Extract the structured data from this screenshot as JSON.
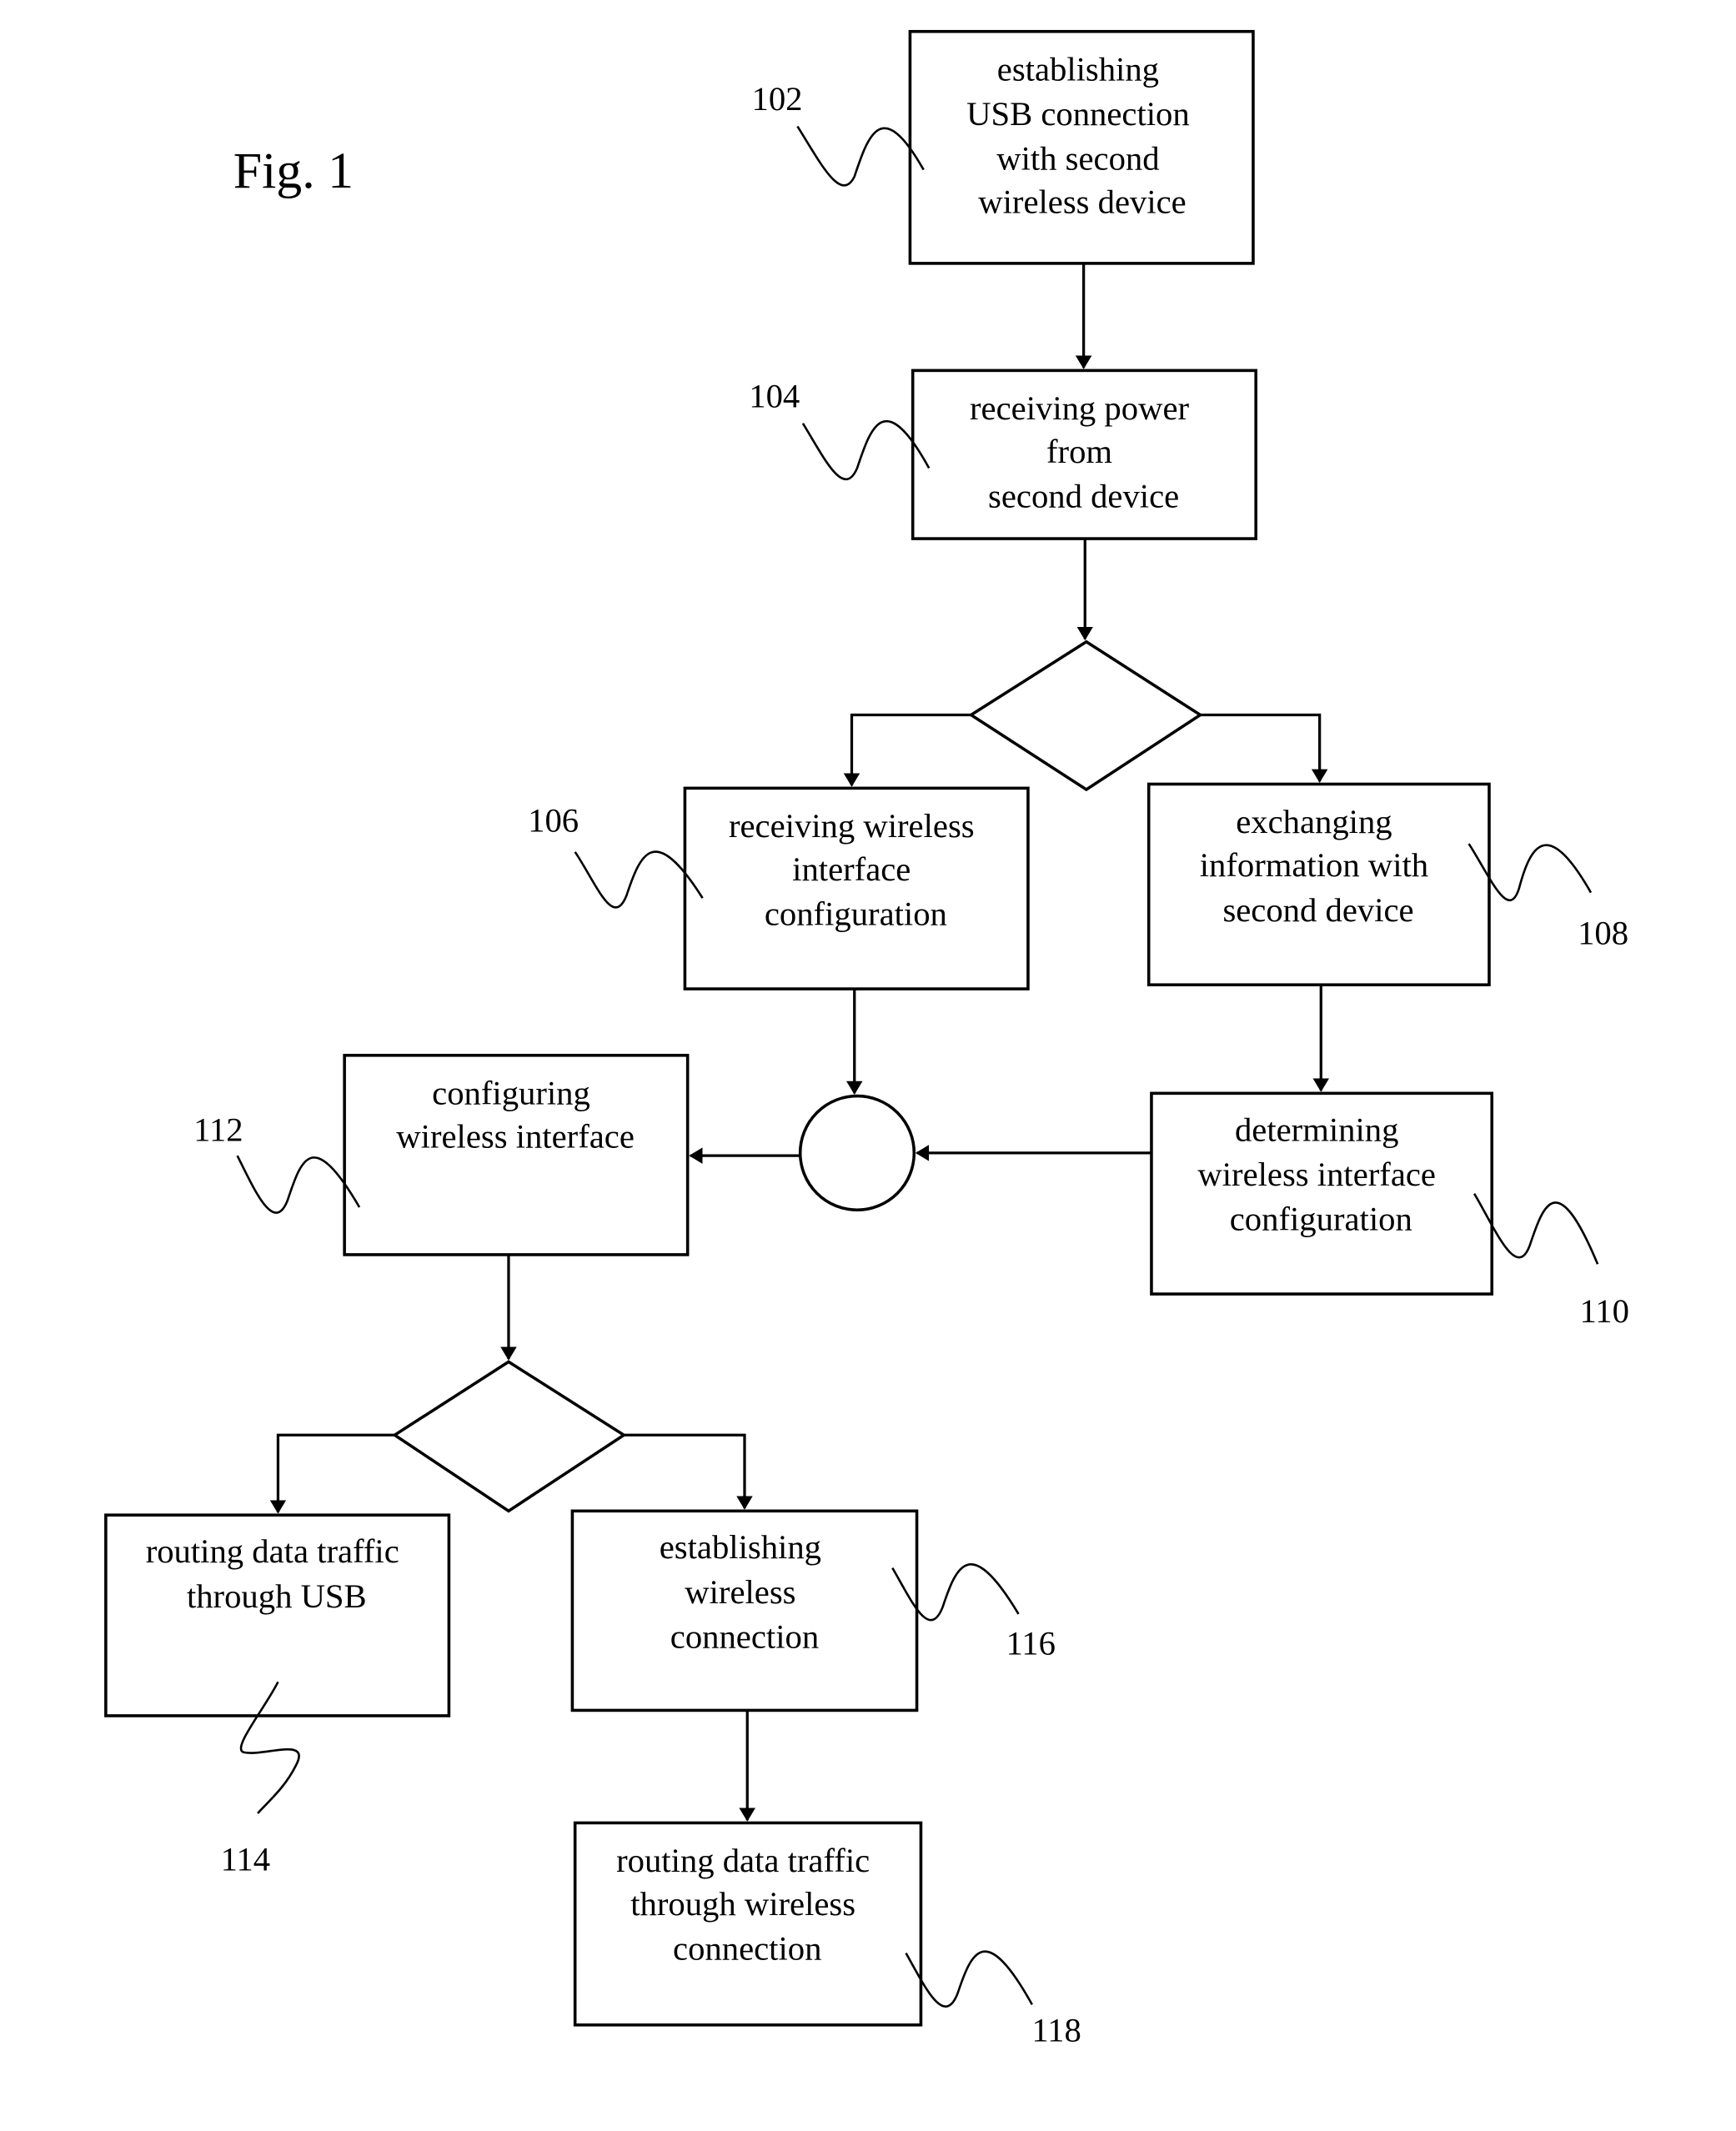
{
  "figure": {
    "title": "Fig. 1"
  },
  "steps": [
    {
      "id": "102",
      "ref": "102",
      "lines": [
        "establishing",
        "USB connection",
        "with second",
        "wireless device"
      ]
    },
    {
      "id": "104",
      "ref": "104",
      "lines": [
        "receiving power",
        "from",
        "second device"
      ]
    },
    {
      "id": "106",
      "ref": "106",
      "lines": [
        "receiving wireless",
        "interface",
        "configuration"
      ]
    },
    {
      "id": "108",
      "ref": "108",
      "lines": [
        "exchanging",
        "information with",
        "second device"
      ]
    },
    {
      "id": "110",
      "ref": "110",
      "lines": [
        "determining",
        "wireless interface",
        "configuration"
      ]
    },
    {
      "id": "112",
      "ref": "112",
      "lines": [
        "configuring",
        "wireless interface"
      ]
    },
    {
      "id": "114",
      "ref": "114",
      "lines": [
        "routing data traffic",
        "through USB"
      ]
    },
    {
      "id": "116",
      "ref": "116",
      "lines": [
        "establishing",
        "wireless",
        "connection"
      ]
    },
    {
      "id": "118",
      "ref": "118",
      "lines": [
        "routing data traffic",
        "through wireless",
        "connection"
      ]
    }
  ],
  "decisions": [
    {
      "id": "decision-1",
      "after": "104",
      "branches": [
        "106",
        "108"
      ]
    },
    {
      "id": "decision-2",
      "after": "112",
      "branches": [
        "114",
        "116"
      ]
    }
  ],
  "connectors": [
    {
      "id": "merge-circle",
      "inputs": [
        "106",
        "110"
      ],
      "output": "112"
    }
  ],
  "edges": [
    [
      "102",
      "104"
    ],
    [
      "104",
      "decision-1"
    ],
    [
      "decision-1",
      "106"
    ],
    [
      "decision-1",
      "108"
    ],
    [
      "108",
      "110"
    ],
    [
      "106",
      "merge-circle"
    ],
    [
      "110",
      "merge-circle"
    ],
    [
      "merge-circle",
      "112"
    ],
    [
      "112",
      "decision-2"
    ],
    [
      "decision-2",
      "114"
    ],
    [
      "decision-2",
      "116"
    ],
    [
      "116",
      "118"
    ]
  ]
}
